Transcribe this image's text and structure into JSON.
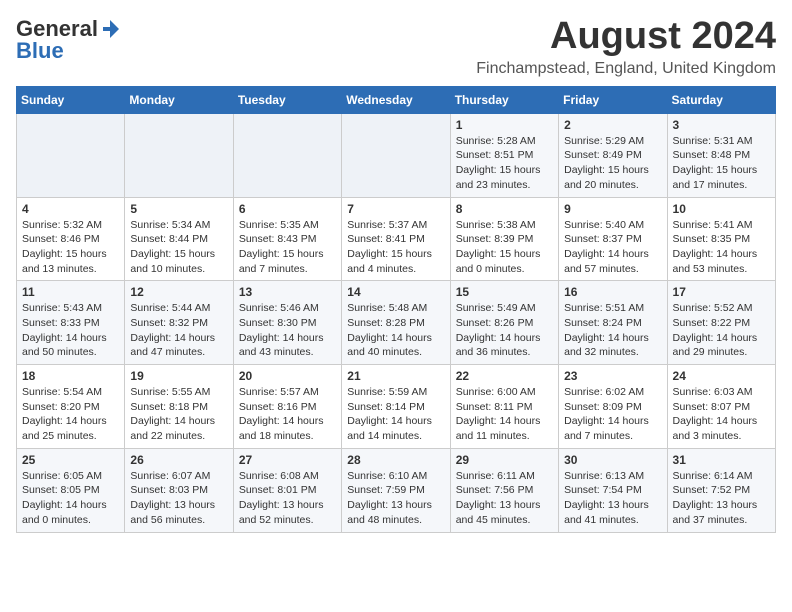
{
  "header": {
    "logo": {
      "general": "General",
      "blue": "Blue",
      "icon": "▶"
    },
    "title": "August 2024",
    "subtitle": "Finchampstead, England, United Kingdom"
  },
  "calendar": {
    "days_of_week": [
      "Sunday",
      "Monday",
      "Tuesday",
      "Wednesday",
      "Thursday",
      "Friday",
      "Saturday"
    ],
    "weeks": [
      [
        {
          "day": "",
          "info": ""
        },
        {
          "day": "",
          "info": ""
        },
        {
          "day": "",
          "info": ""
        },
        {
          "day": "",
          "info": ""
        },
        {
          "day": "1",
          "info": "Sunrise: 5:28 AM\nSunset: 8:51 PM\nDaylight: 15 hours\nand 23 minutes."
        },
        {
          "day": "2",
          "info": "Sunrise: 5:29 AM\nSunset: 8:49 PM\nDaylight: 15 hours\nand 20 minutes."
        },
        {
          "day": "3",
          "info": "Sunrise: 5:31 AM\nSunset: 8:48 PM\nDaylight: 15 hours\nand 17 minutes."
        }
      ],
      [
        {
          "day": "4",
          "info": "Sunrise: 5:32 AM\nSunset: 8:46 PM\nDaylight: 15 hours\nand 13 minutes."
        },
        {
          "day": "5",
          "info": "Sunrise: 5:34 AM\nSunset: 8:44 PM\nDaylight: 15 hours\nand 10 minutes."
        },
        {
          "day": "6",
          "info": "Sunrise: 5:35 AM\nSunset: 8:43 PM\nDaylight: 15 hours\nand 7 minutes."
        },
        {
          "day": "7",
          "info": "Sunrise: 5:37 AM\nSunset: 8:41 PM\nDaylight: 15 hours\nand 4 minutes."
        },
        {
          "day": "8",
          "info": "Sunrise: 5:38 AM\nSunset: 8:39 PM\nDaylight: 15 hours\nand 0 minutes."
        },
        {
          "day": "9",
          "info": "Sunrise: 5:40 AM\nSunset: 8:37 PM\nDaylight: 14 hours\nand 57 minutes."
        },
        {
          "day": "10",
          "info": "Sunrise: 5:41 AM\nSunset: 8:35 PM\nDaylight: 14 hours\nand 53 minutes."
        }
      ],
      [
        {
          "day": "11",
          "info": "Sunrise: 5:43 AM\nSunset: 8:33 PM\nDaylight: 14 hours\nand 50 minutes."
        },
        {
          "day": "12",
          "info": "Sunrise: 5:44 AM\nSunset: 8:32 PM\nDaylight: 14 hours\nand 47 minutes."
        },
        {
          "day": "13",
          "info": "Sunrise: 5:46 AM\nSunset: 8:30 PM\nDaylight: 14 hours\nand 43 minutes."
        },
        {
          "day": "14",
          "info": "Sunrise: 5:48 AM\nSunset: 8:28 PM\nDaylight: 14 hours\nand 40 minutes."
        },
        {
          "day": "15",
          "info": "Sunrise: 5:49 AM\nSunset: 8:26 PM\nDaylight: 14 hours\nand 36 minutes."
        },
        {
          "day": "16",
          "info": "Sunrise: 5:51 AM\nSunset: 8:24 PM\nDaylight: 14 hours\nand 32 minutes."
        },
        {
          "day": "17",
          "info": "Sunrise: 5:52 AM\nSunset: 8:22 PM\nDaylight: 14 hours\nand 29 minutes."
        }
      ],
      [
        {
          "day": "18",
          "info": "Sunrise: 5:54 AM\nSunset: 8:20 PM\nDaylight: 14 hours\nand 25 minutes."
        },
        {
          "day": "19",
          "info": "Sunrise: 5:55 AM\nSunset: 8:18 PM\nDaylight: 14 hours\nand 22 minutes."
        },
        {
          "day": "20",
          "info": "Sunrise: 5:57 AM\nSunset: 8:16 PM\nDaylight: 14 hours\nand 18 minutes."
        },
        {
          "day": "21",
          "info": "Sunrise: 5:59 AM\nSunset: 8:14 PM\nDaylight: 14 hours\nand 14 minutes."
        },
        {
          "day": "22",
          "info": "Sunrise: 6:00 AM\nSunset: 8:11 PM\nDaylight: 14 hours\nand 11 minutes."
        },
        {
          "day": "23",
          "info": "Sunrise: 6:02 AM\nSunset: 8:09 PM\nDaylight: 14 hours\nand 7 minutes."
        },
        {
          "day": "24",
          "info": "Sunrise: 6:03 AM\nSunset: 8:07 PM\nDaylight: 14 hours\nand 3 minutes."
        }
      ],
      [
        {
          "day": "25",
          "info": "Sunrise: 6:05 AM\nSunset: 8:05 PM\nDaylight: 14 hours\nand 0 minutes."
        },
        {
          "day": "26",
          "info": "Sunrise: 6:07 AM\nSunset: 8:03 PM\nDaylight: 13 hours\nand 56 minutes."
        },
        {
          "day": "27",
          "info": "Sunrise: 6:08 AM\nSunset: 8:01 PM\nDaylight: 13 hours\nand 52 minutes."
        },
        {
          "day": "28",
          "info": "Sunrise: 6:10 AM\nSunset: 7:59 PM\nDaylight: 13 hours\nand 48 minutes."
        },
        {
          "day": "29",
          "info": "Sunrise: 6:11 AM\nSunset: 7:56 PM\nDaylight: 13 hours\nand 45 minutes."
        },
        {
          "day": "30",
          "info": "Sunrise: 6:13 AM\nSunset: 7:54 PM\nDaylight: 13 hours\nand 41 minutes."
        },
        {
          "day": "31",
          "info": "Sunrise: 6:14 AM\nSunset: 7:52 PM\nDaylight: 13 hours\nand 37 minutes."
        }
      ]
    ]
  }
}
